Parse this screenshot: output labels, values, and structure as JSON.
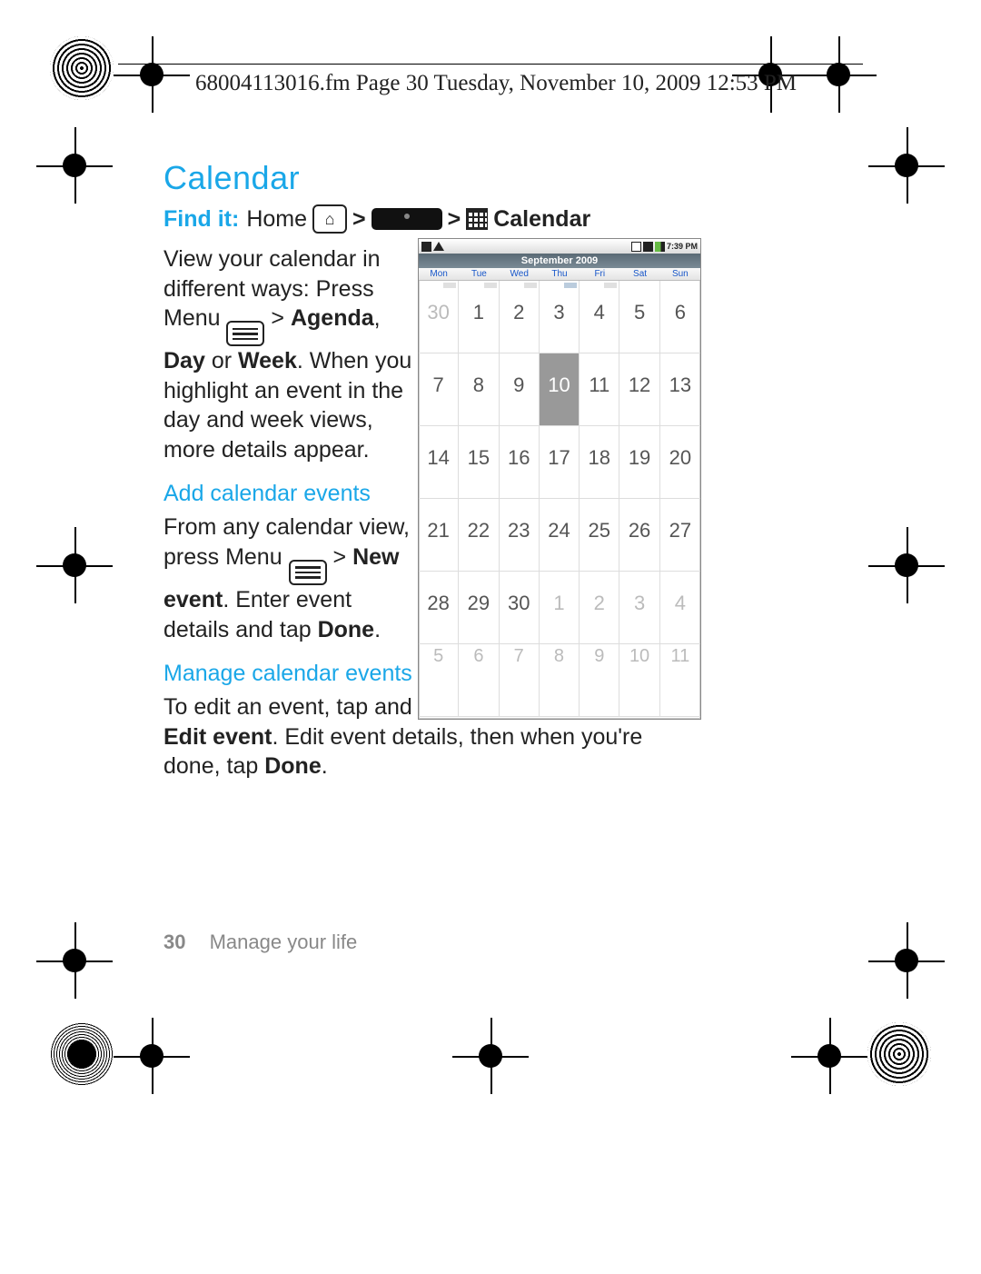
{
  "crop_header": "68004113016.fm  Page 30  Tuesday, November 10, 2009  12:53 PM",
  "title": "Calendar",
  "findit": {
    "lead": "Find it:",
    "home": "Home",
    "sep": ">",
    "calendar": "Calendar"
  },
  "intro": {
    "l1": "View your calendar in different ways: Press Menu ",
    "l2": " >",
    "bold_agenda": "Agenda",
    "comma": ", ",
    "bold_day": "Day",
    "or": " or ",
    "bold_week": "Week",
    "rest": ". When you highlight an event in the day and week views, more details appear."
  },
  "h_add": "Add calendar events",
  "add": {
    "a": "From any calendar view, press Menu ",
    "b": " > ",
    "new_event": "New event",
    "c": ". Enter event details and tap ",
    "done": "Done",
    "d": "."
  },
  "h_manage": "Manage calendar events",
  "manage": {
    "a": "To edit an event, tap and hold the event, then tap ",
    "edit_event": "Edit event",
    "b": ". Edit event details, then when you're done, tap ",
    "done": "Done",
    "c": "."
  },
  "footer": {
    "page_num": "30",
    "section": "Manage your life"
  },
  "phone": {
    "time": "7:39 PM",
    "month": "September 2009",
    "dow": [
      "Mon",
      "Tue",
      "Wed",
      "Thu",
      "Fri",
      "Sat",
      "Sun"
    ],
    "cells": [
      {
        "n": "30",
        "fade": true,
        "mark": true
      },
      {
        "n": "1",
        "mark": true
      },
      {
        "n": "2",
        "mark": true
      },
      {
        "n": "3",
        "mark": true,
        "hl": true
      },
      {
        "n": "4",
        "mark": true
      },
      {
        "n": "5"
      },
      {
        "n": "6"
      },
      {
        "n": "7"
      },
      {
        "n": "8"
      },
      {
        "n": "9"
      },
      {
        "n": "10",
        "sel": true
      },
      {
        "n": "11"
      },
      {
        "n": "12"
      },
      {
        "n": "13"
      },
      {
        "n": "14"
      },
      {
        "n": "15"
      },
      {
        "n": "16"
      },
      {
        "n": "17"
      },
      {
        "n": "18"
      },
      {
        "n": "19"
      },
      {
        "n": "20"
      },
      {
        "n": "21"
      },
      {
        "n": "22"
      },
      {
        "n": "23"
      },
      {
        "n": "24"
      },
      {
        "n": "25"
      },
      {
        "n": "26"
      },
      {
        "n": "27"
      },
      {
        "n": "28"
      },
      {
        "n": "29"
      },
      {
        "n": "30"
      },
      {
        "n": "1",
        "fade": true
      },
      {
        "n": "2",
        "fade": true
      },
      {
        "n": "3",
        "fade": true
      },
      {
        "n": "4",
        "fade": true
      },
      {
        "n": "5",
        "fade": true,
        "last": true
      },
      {
        "n": "6",
        "fade": true,
        "last": true
      },
      {
        "n": "7",
        "fade": true,
        "last": true
      },
      {
        "n": "8",
        "fade": true,
        "last": true
      },
      {
        "n": "9",
        "fade": true,
        "last": true
      },
      {
        "n": "10",
        "fade": true,
        "last": true
      },
      {
        "n": "11",
        "fade": true,
        "last": true
      }
    ]
  }
}
